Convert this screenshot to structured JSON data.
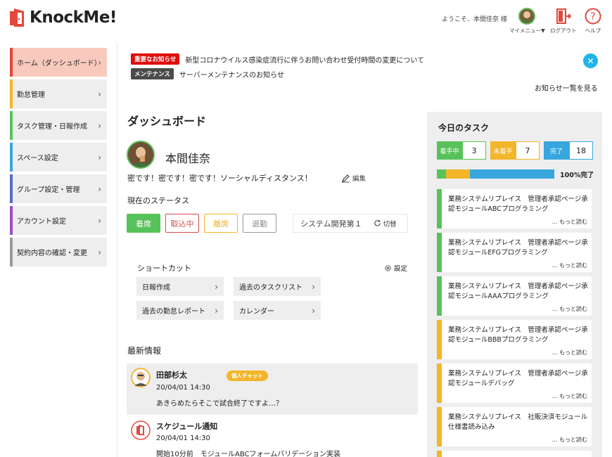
{
  "header": {
    "logo_text": "KnockMe!",
    "welcome": "ようこそ、本間佳奈 様",
    "my_menu": "マイメニュー▼",
    "logout": "ログアウト",
    "help": "ヘルプ"
  },
  "colors": {
    "brand_red": "#e2483c",
    "green": "#58c25a",
    "yellow": "#f3b52a",
    "blue": "#38a7de",
    "red": "#d64a4a",
    "gray": "#999999",
    "close_blue": "#1fb5e8"
  },
  "sidebar": {
    "items": [
      {
        "label": "ホーム（ダッシュボード）",
        "color": "#e2483c",
        "active": true
      },
      {
        "label": "勤怠管理",
        "color": "#f3b52a"
      },
      {
        "label": "タスク管理・日報作成",
        "color": "#58c25a"
      },
      {
        "label": "スペース設定",
        "color": "#38a7de"
      },
      {
        "label": "グループ設定・管理",
        "color": "#5b6bc7"
      },
      {
        "label": "アカウント設定",
        "color": "#9c4fc6"
      },
      {
        "label": "契約内容の確認・変更",
        "color": "#9a9a9a"
      }
    ]
  },
  "notices": {
    "items": [
      {
        "tag": "重要なお知らせ",
        "tag_color": "#e00b0b",
        "text": "新型コロナウイルス感染症流行に伴うお問い合わせ受付時間の変更について"
      },
      {
        "tag": "メンテナンス",
        "tag_color": "#4b4b4b",
        "text": "サーバーメンテナンスのお知らせ"
      }
    ],
    "all_link": "お知らせ一覧を見る"
  },
  "dashboard": {
    "title": "ダッシュボード",
    "user_name": "本間佳奈",
    "message": "密です！密です！密です！ソーシャルディスタンス！",
    "edit": "編集",
    "status_title": "現在のステータス",
    "statuses": [
      "着席",
      "取込中",
      "離席",
      "退勤"
    ],
    "team": "システム開発第１",
    "switch": "切替",
    "shortcut_title": "ショートカット",
    "shortcut_setting": "設定",
    "shortcuts": [
      "日報作成",
      "過去のタスクリスト",
      "過去の勤怠レポート",
      "カレンダー"
    ],
    "news_title": "最新情報",
    "news": [
      {
        "name": "田部杉太",
        "badge": "個人チャット",
        "date": "20/04/01 14:30",
        "text": "あきらめたらそこで試合終了ですよ…？"
      },
      {
        "name": "スケジュール通知",
        "date": "20/04/01 14:30",
        "text": "開始10分前　モジュールABCフォームバリデーション実装"
      }
    ]
  },
  "tasks": {
    "title": "今日のタスク",
    "counts": [
      {
        "label": "着手中",
        "value": "3"
      },
      {
        "label": "未着手",
        "value": "7"
      },
      {
        "label": "完了",
        "value": "18"
      }
    ],
    "progress": {
      "green": 0.08,
      "yellow": 0.2,
      "blue": 0.72
    },
    "progress_label": "100%完了",
    "more": "… もっと読む",
    "items": [
      {
        "text": "業務システムリプレイス　管理者承認ページ承認モジュールABCプログラミング",
        "status": "green"
      },
      {
        "text": "業務システムリプレイス　管理者承認ページ承認モジュールEFGプログラミング",
        "status": "green"
      },
      {
        "text": "業務システムリプレイス　管理者承認ページ承認モジュールAAAプログラミング",
        "status": "green"
      },
      {
        "text": "業務システムリプレイス　管理者承認ページ承認モジュールBBBプログラミング",
        "status": "yellow"
      },
      {
        "text": "業務システムリプレイス　管理者承認ページ承認モジュールデバッグ",
        "status": "yellow"
      },
      {
        "text": "業務システムリプレイス　社販決済モジュール仕様書読み込み",
        "status": "yellow"
      }
    ]
  }
}
